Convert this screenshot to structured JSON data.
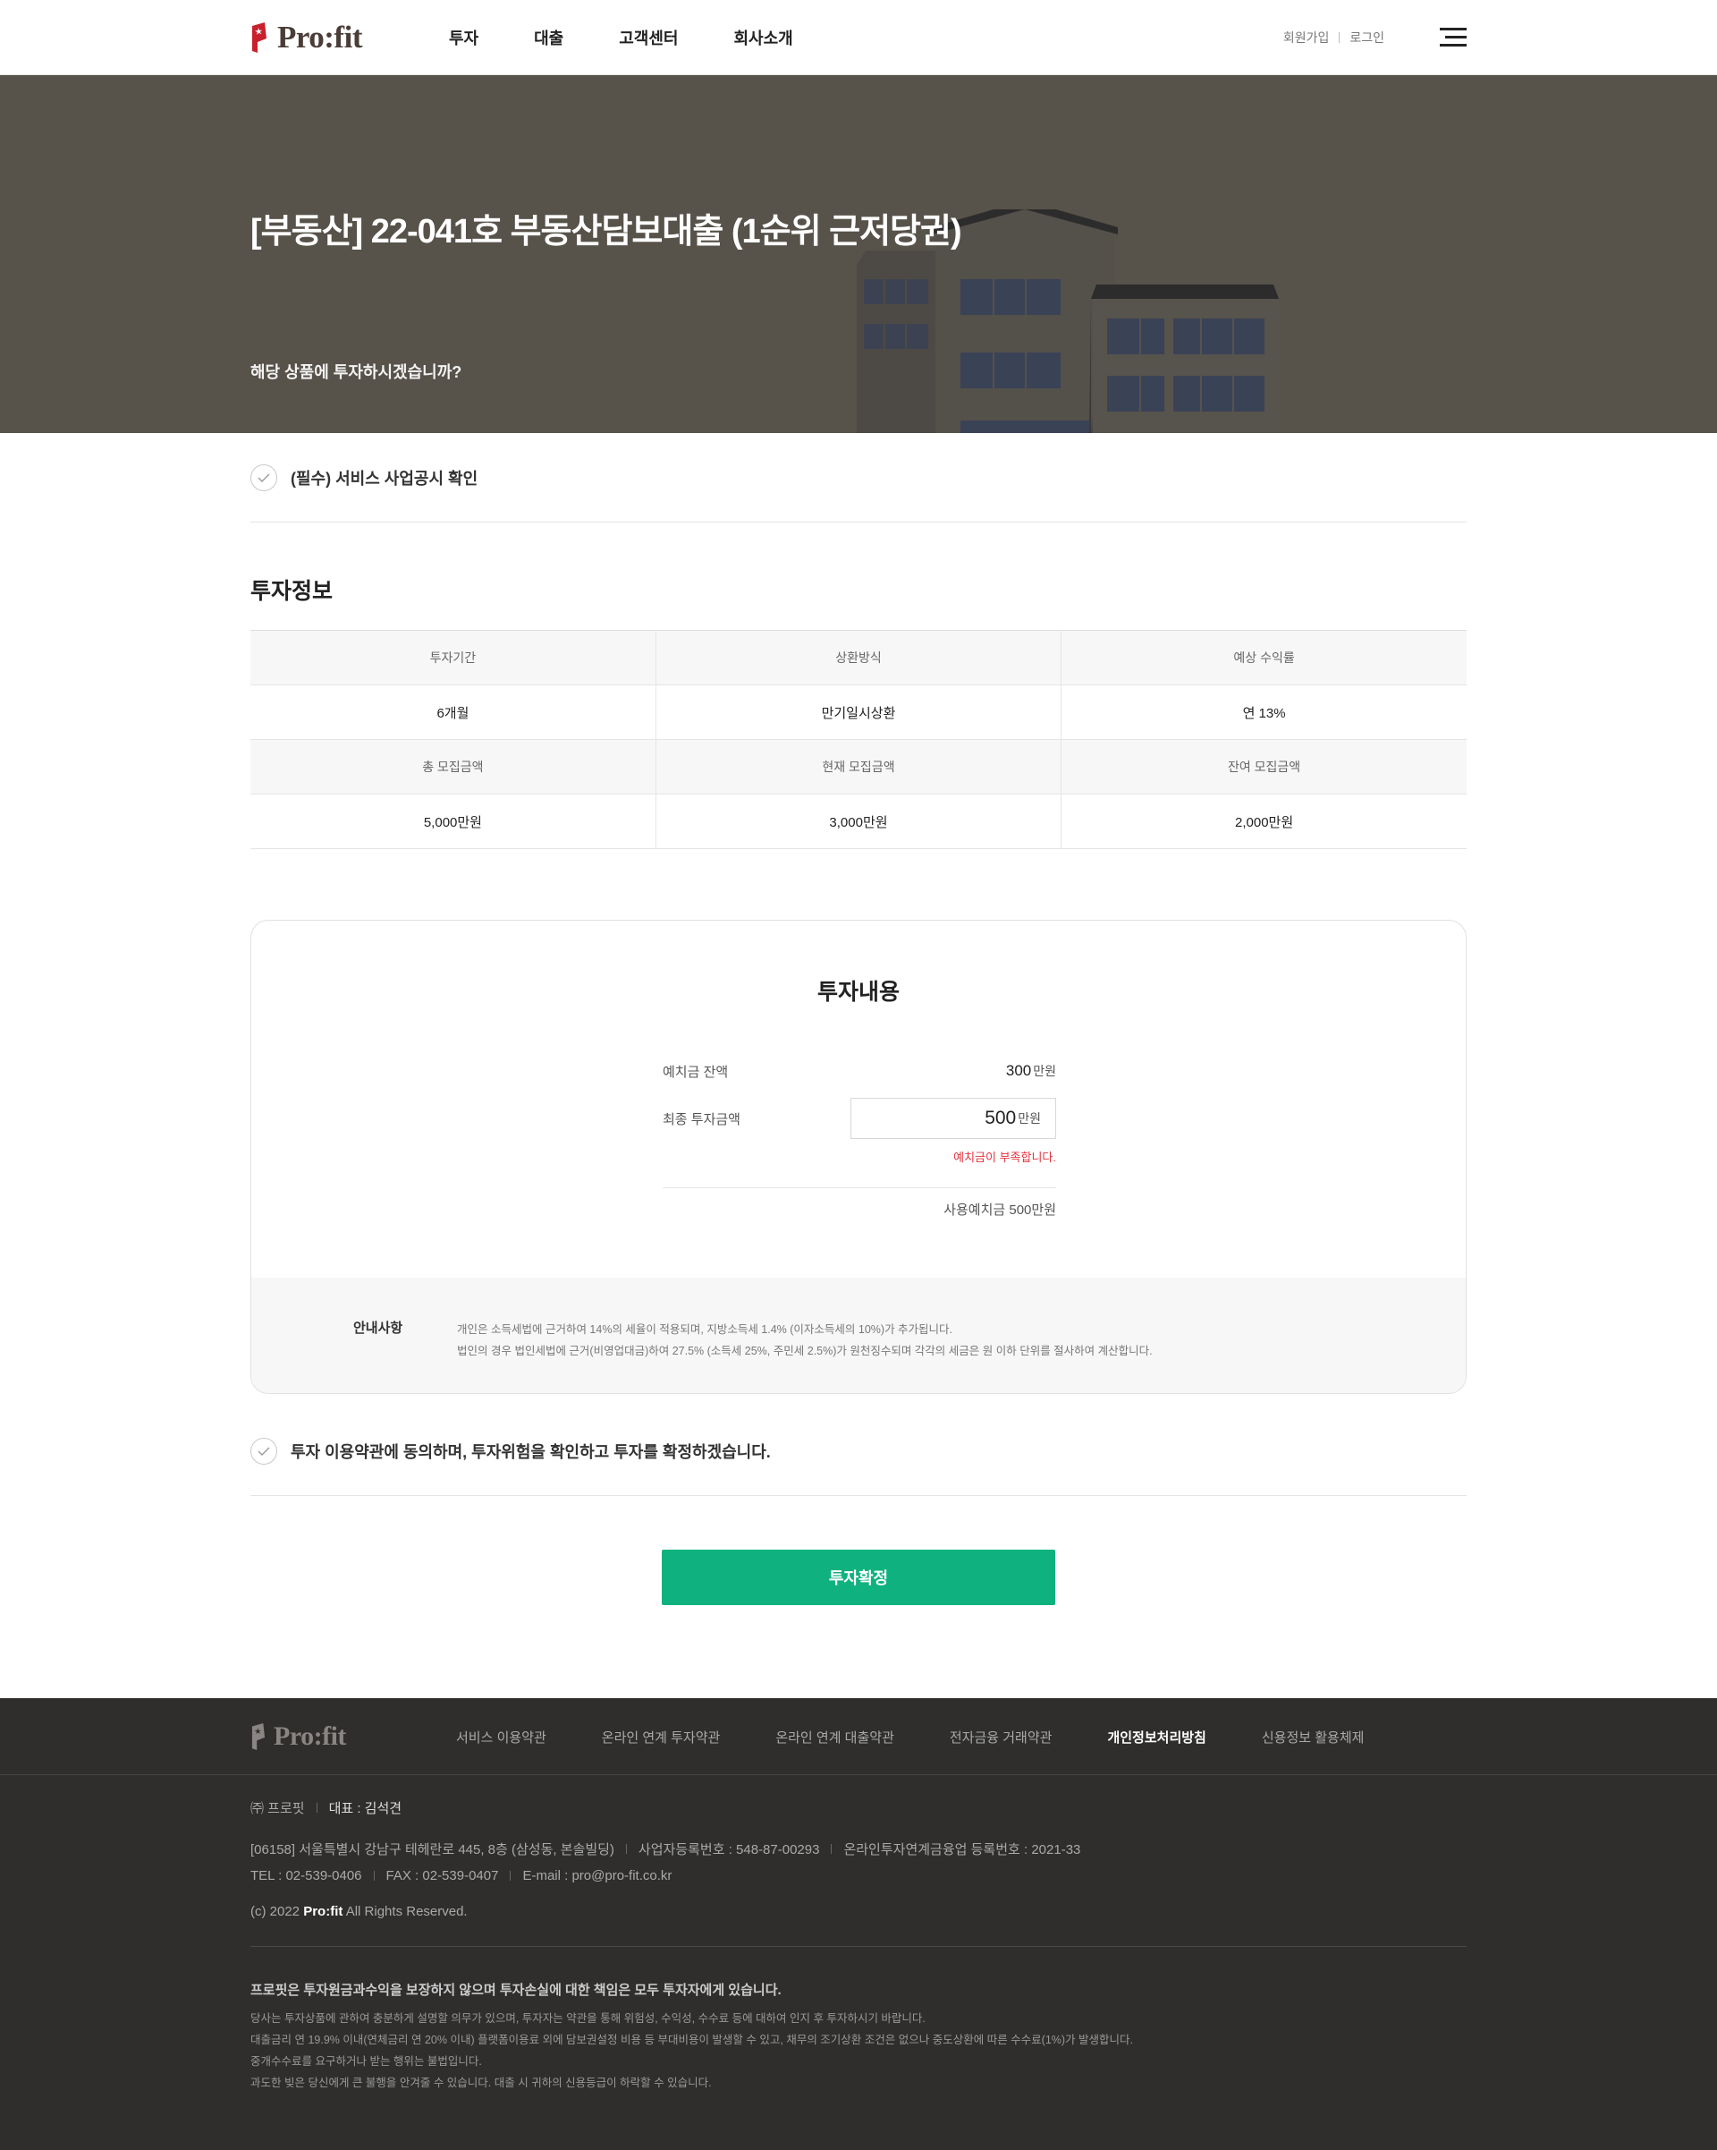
{
  "header": {
    "logo_text": "Pro:fit",
    "nav": [
      "투자",
      "대출",
      "고객센터",
      "회사소개"
    ],
    "join": "회원가입",
    "login": "로그인"
  },
  "hero": {
    "title": "[부동산] 22-041호 부동산담보대출 (1순위 근저당권)",
    "subtitle": "해당 상품에 투자하시겠습니까?"
  },
  "notice_check": {
    "label": "(필수) 서비스 사업공시 확인"
  },
  "invest_info": {
    "title": "투자정보",
    "row1_headers": [
      "투자기간",
      "상환방식",
      "예상 수익률"
    ],
    "row1_values": [
      "6개월",
      "만기일시상환",
      "연 13%"
    ],
    "row2_headers": [
      "총 모집금액",
      "현재 모집금액",
      "잔여 모집금액"
    ],
    "row2_values": [
      "5,000만원",
      "3,000만원",
      "2,000만원"
    ]
  },
  "invest_content": {
    "title": "투자내용",
    "deposit_label": "예치금 잔액",
    "deposit_value": "300",
    "unit": "만원",
    "final_label": "최종 투자금액",
    "final_value": "500",
    "error": "예치금이 부족합니다.",
    "used_deposit": "사용예치금 500만원",
    "notice_title": "안내사항",
    "notice_lines": [
      "개인은 소득세법에 근거하여 14%의 세율이 적용되며, 지방소득세 1.4% (이자소득세의 10%)가 추가됩니다.",
      "법인의 경우 법인세법에 근거(비영업대금)하여 27.5% (소득세 25%, 주민세 2.5%)가 원천징수되며 각각의 세금은 원 이하 단위를 절사하여 계산합니다."
    ]
  },
  "agree": {
    "label": "투자 이용약관에 동의하며, 투자위험을 확인하고 투자를 확정하겠습니다."
  },
  "confirm_button": "투자확정",
  "footer": {
    "logo_text": "Pro:fit",
    "links": [
      "서비스 이용약관",
      "온라인 연계 투자약관",
      "온라인 연계 대출약관",
      "전자금융 거래약관",
      "개인정보처리방침",
      "신용정보 활용체제"
    ],
    "company": "㈜ 프로핏",
    "ceo": "대표 : 김석견",
    "address": "[06158] 서울특별시 강남구 테헤란로 445, 8층 (삼성동, 본솔빌딩)",
    "biz_no": "사업자등록번호 : 548-87-00293",
    "p2p_no": "온라인투자연계금융업 등록번호 : 2021-33",
    "tel": "TEL : 02-539-0406",
    "fax": "FAX : 02-539-0407",
    "email": "E-mail : pro@pro-fit.co.kr",
    "copy_prefix": "(c) 2022 ",
    "copy_brand": "Pro:fit",
    "copy_suffix": " All Rights Reserved.",
    "warning_title": "프로핏은 투자원금과수익을 보장하지 않으며 투자손실에 대한 책임은 모두 투자자에게 있습니다.",
    "warning_lines": [
      "당사는 투자상품에 관하여 충분하게 설명할 의무가 있으며, 투자자는 약관을 통해 위험성, 수익성, 수수료 등에 대하여 인지 후 투자하시기 바랍니다.",
      "대출금리 연 19.9% 이내(연체금리 연 20% 이내) 플랫폼이용료 외에 담보권설정 비용 등 부대비용이 발생할 수 있고, 채무의 조기상환 조건은 없으나 중도상환에 따른 수수료(1%)가 발생합니다.",
      "중개수수료를 요구하거나 받는 행위는 불법입니다.",
      "과도한 빚은 당신에게 큰 불행을 안겨줄 수 있습니다. 대출 시 귀하의 신용등급이 하락할 수 있습니다."
    ]
  },
  "colors": {
    "brand_red": "#c8202d",
    "confirm_green": "#0fb27e",
    "hero_bg": "#57524a",
    "footer_bg": "#2f2e2d",
    "error_red": "#e5333e"
  }
}
